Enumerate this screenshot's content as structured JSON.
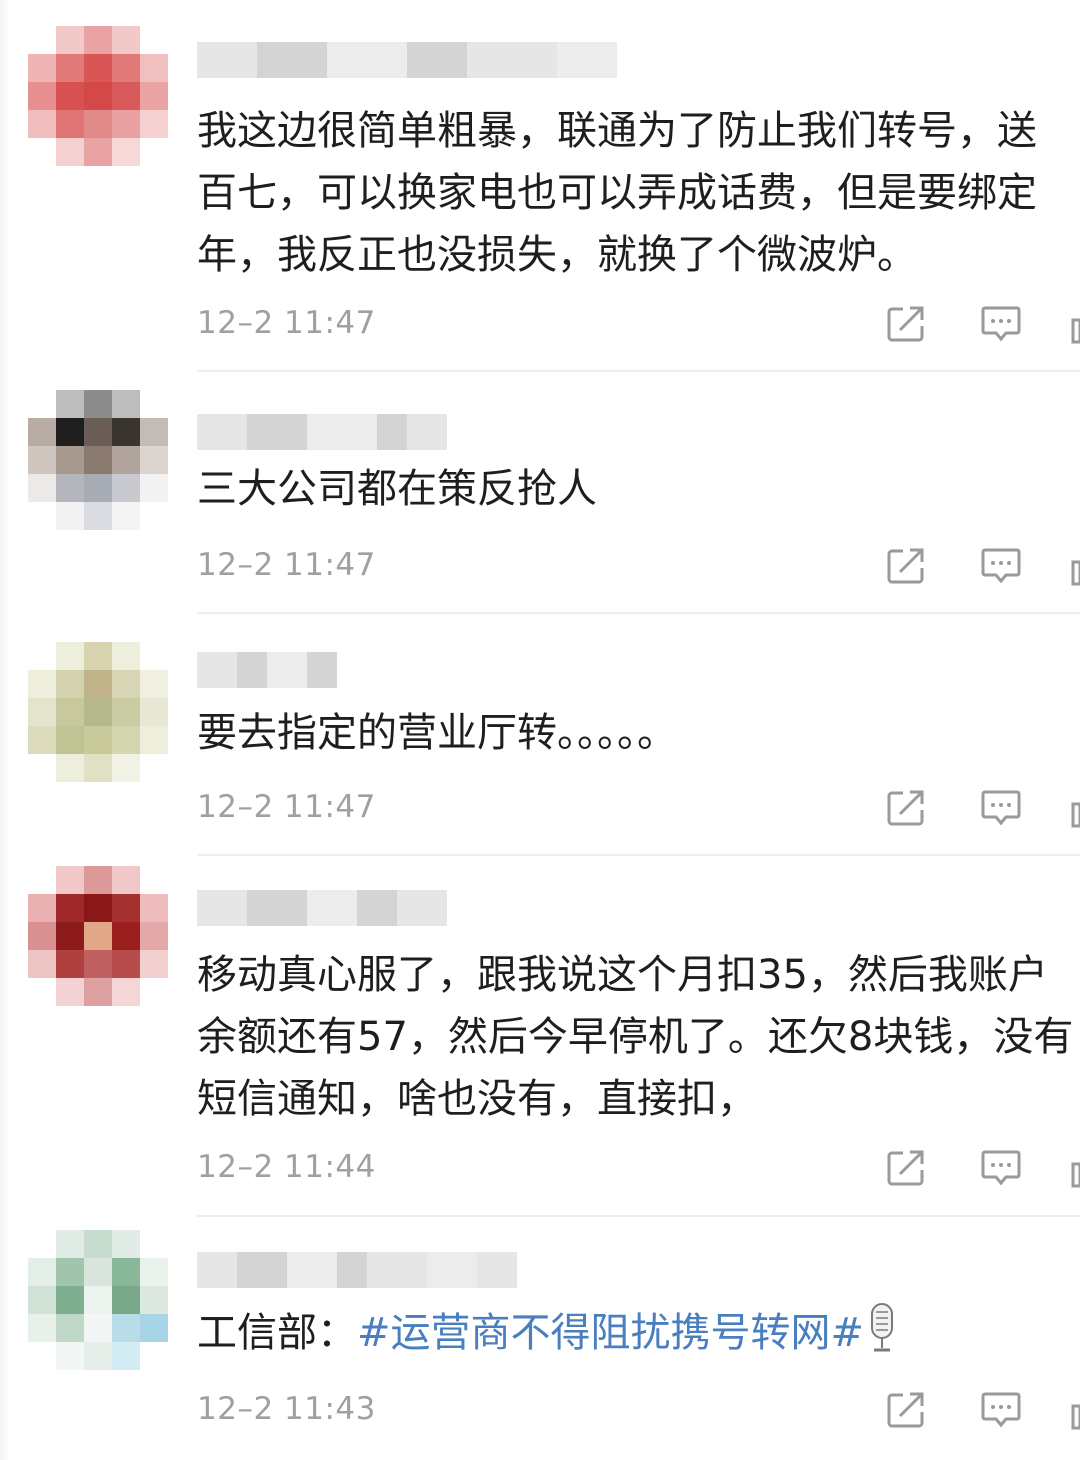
{
  "comments": [
    {
      "lines": [
        "我这边很简单粗暴，联通为了防止我们转号，送",
        "百七，可以换家电也可以弄成话费，但是要绑定",
        "年，我反正也没损失，就换了个微波炉。"
      ],
      "time": "12–2 11:47"
    },
    {
      "lines": [
        "三大公司都在策反抢人"
      ],
      "time": "12–2 11:47"
    },
    {
      "lines": [
        "要去指定的营业厅转。。。。。"
      ],
      "time": "12–2 11:47"
    },
    {
      "lines": [
        "移动真心服了，跟我说这个月扣35，然后我账户",
        "余额还有57，然后今早停机了。还欠8块钱，没有",
        "短信通知，啥也没有，直接扣，"
      ],
      "time": "12–2 11:44"
    },
    {
      "prefix": "工信部：",
      "hashtag": "#运营商不得阻扰携号转网#",
      "time": "12–2 11:43"
    }
  ],
  "icons": {
    "share": "share-icon",
    "comment": "comment-icon",
    "like": "like-icon",
    "mic": "microphone-icon"
  },
  "colors": {
    "text": "#1e1e1e",
    "time": "#a0a0a0",
    "hashtag": "#4a7fbf",
    "icon": "#9a9a9a"
  }
}
